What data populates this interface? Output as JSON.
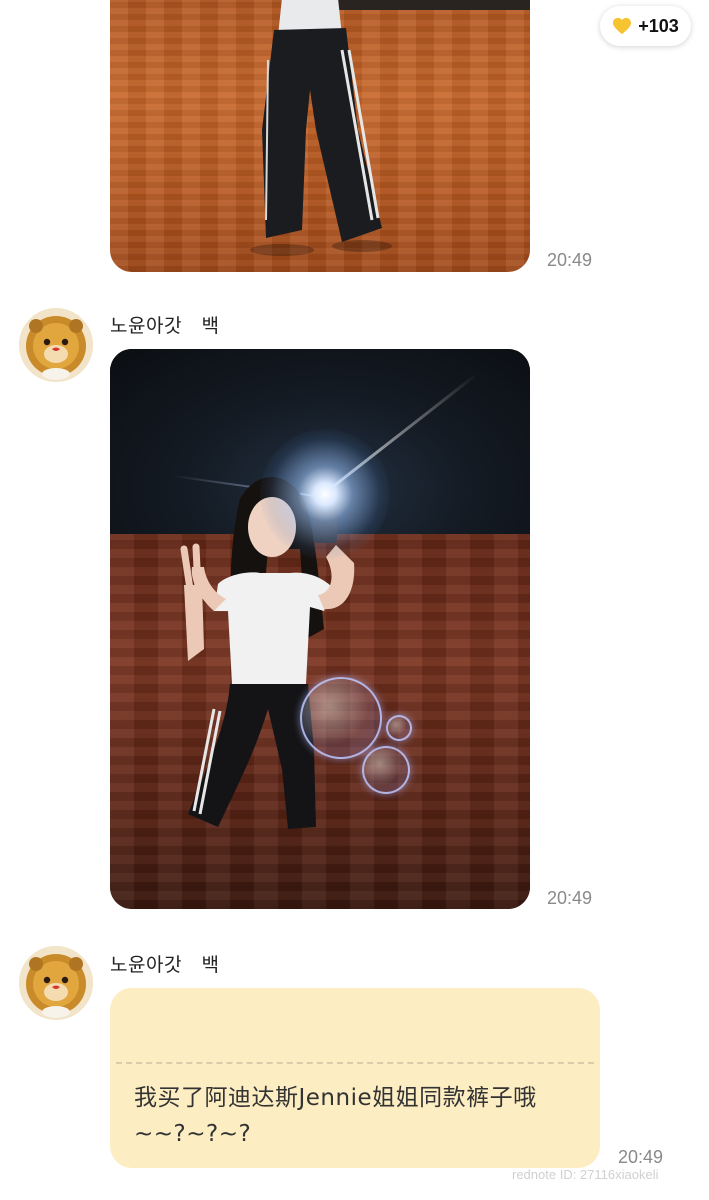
{
  "badge": {
    "icon": "yellow-heart-icon",
    "count": "+103",
    "color": "#f6c430"
  },
  "messages": [
    {
      "type": "image",
      "time": "20:49"
    },
    {
      "type": "image",
      "sender": "노윤아갓   백",
      "time": "20:49",
      "avatar": "lion-plush-avatar"
    },
    {
      "type": "text",
      "sender": "노윤아갓   백",
      "time": "20:49",
      "avatar": "lion-plush-avatar",
      "text": "我买了阿迪达斯Jennie姐姐同款裤子哦~~?~?~?",
      "bubble_color": "#fcedc2"
    }
  ],
  "watermark": "rednote ID: 27116xiaokeli"
}
